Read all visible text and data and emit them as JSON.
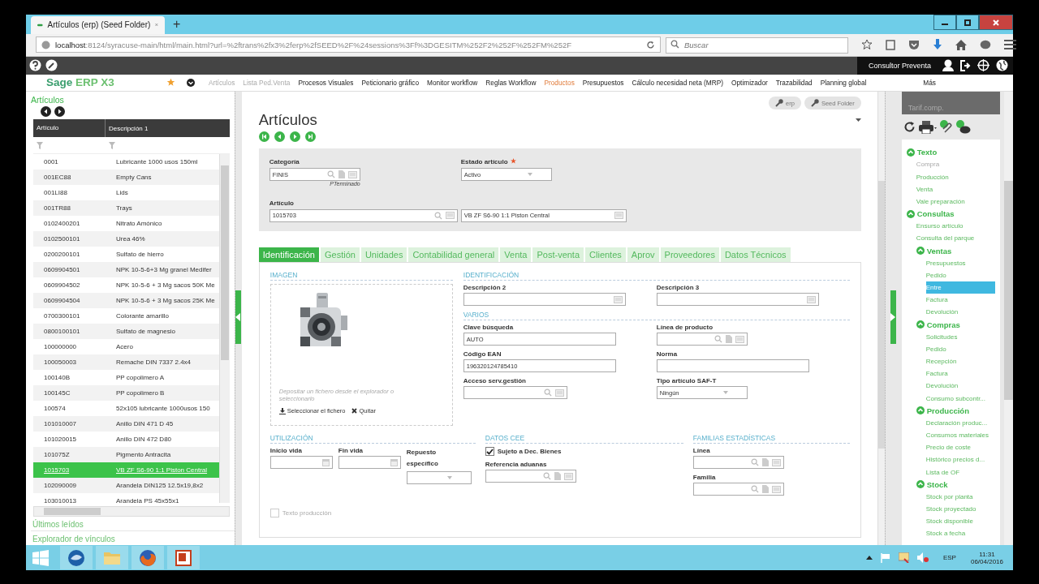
{
  "browser": {
    "tab_title": "Artículos (erp) (Seed Folder)",
    "new_tab": "+",
    "url_host": "localhost",
    "url_rest": ":8124/syracuse-main/html/main.html?url=%2ftrans%2fx3%2ferp%2fSEED%2F%24sessions%3Ff%3DGESITM%252F2%252F%252FM%252F",
    "search_placeholder": "Buscar"
  },
  "user": "Consultor Preventa",
  "app": {
    "logo_main": "Sage",
    "logo_sub": "ERP X3",
    "nav": [
      {
        "label": "Artículos",
        "recent": true,
        "selected": false
      },
      {
        "label": "Lista Ped.Venta",
        "recent": true,
        "selected": false
      },
      {
        "label": "Procesos Visuales",
        "recent": false,
        "selected": false
      },
      {
        "label": "Peticionario gráfico",
        "recent": false,
        "selected": false
      },
      {
        "label": "Monitor workflow",
        "recent": false,
        "selected": false
      },
      {
        "label": "Reglas Workflow",
        "recent": false,
        "selected": false
      },
      {
        "label": "Productos",
        "recent": false,
        "selected": true
      },
      {
        "label": "Presupuestos",
        "recent": false,
        "selected": false
      },
      {
        "label": "Cálculo necesidad neta (MRP)",
        "recent": false,
        "selected": false
      },
      {
        "label": "Optimizador",
        "recent": false,
        "selected": false
      },
      {
        "label": "Trazabilidad",
        "recent": false,
        "selected": false
      },
      {
        "label": "Planning global",
        "recent": false,
        "selected": false
      },
      {
        "label": "Más",
        "recent": false,
        "selected": false
      }
    ]
  },
  "left_panel": {
    "title": "Artículos",
    "columns": [
      "Artículo",
      "Descripción 1"
    ],
    "rows": [
      {
        "code": "0001",
        "desc": "Lubricante 1000 usos 150ml",
        "selected": false
      },
      {
        "code": "001EC88",
        "desc": "Empty Cans",
        "selected": false
      },
      {
        "code": "001LI88",
        "desc": "Lids",
        "selected": false
      },
      {
        "code": "001TR88",
        "desc": "Trays",
        "selected": false
      },
      {
        "code": "0102400201",
        "desc": "Nitrato Amónico",
        "selected": false
      },
      {
        "code": "0102500101",
        "desc": "Urea 46%",
        "selected": false
      },
      {
        "code": "0200200101",
        "desc": "Sulfato de hierro",
        "selected": false
      },
      {
        "code": "0609904501",
        "desc": "NPK 10-5-6+3 Mg granel Medifer",
        "selected": false
      },
      {
        "code": "0609904502",
        "desc": "NPK 10-5-6 + 3 Mg sacos 50K Me",
        "selected": false
      },
      {
        "code": "0609904504",
        "desc": "NPK 10-5-6 + 3 Mg sacos 25K Me",
        "selected": false
      },
      {
        "code": "0700300101",
        "desc": "Colorante amarillo",
        "selected": false
      },
      {
        "code": "0800100101",
        "desc": "Sulfato de magnesio",
        "selected": false
      },
      {
        "code": "100000000",
        "desc": "Acero",
        "selected": false
      },
      {
        "code": "100050003",
        "desc": "Remache DIN 7337 2.4x4",
        "selected": false
      },
      {
        "code": "100140B",
        "desc": "PP copolimero A",
        "selected": false
      },
      {
        "code": "100145C",
        "desc": "PP copolimero B",
        "selected": false
      },
      {
        "code": "100574",
        "desc": "52x105 lubricante 1000usos 150",
        "selected": false
      },
      {
        "code": "101010007",
        "desc": "Anillo DIN 471 D 45",
        "selected": false
      },
      {
        "code": "101020015",
        "desc": "Anillo DIN 472 D80",
        "selected": false
      },
      {
        "code": "101075Z",
        "desc": "Pigmento Antracita",
        "selected": false
      },
      {
        "code": "1015703",
        "desc": "VB ZF S6-90 1:1 Piston Central",
        "selected": true
      },
      {
        "code": "102090009",
        "desc": "Arandela DIN125 12.5x19,8x2",
        "selected": false
      },
      {
        "code": "103010013",
        "desc": "Arandela PS 45x55x1",
        "selected": false
      }
    ],
    "links": [
      "Últimos leídos",
      "Explorador de vínculos"
    ]
  },
  "main": {
    "chips": [
      "erp",
      "Seed Folder"
    ],
    "title": "Artículos",
    "header_fields": [
      {
        "label": "Categoría",
        "kind": "lookup",
        "value": "FINIS",
        "hint": "PTerminado"
      },
      {
        "label": "Estado artículo",
        "kind": "select",
        "value": "Activo",
        "required": true
      },
      {
        "label": "Artículo",
        "kind": "search",
        "value": "1015703"
      },
      {
        "kind": "memo",
        "value": "VB ZF S6-90 1:1 Piston Central"
      }
    ],
    "tabs": [
      {
        "label": "Identificación",
        "selected": true
      },
      {
        "label": "Gestión",
        "selected": false
      },
      {
        "label": "Unidades",
        "selected": false
      },
      {
        "label": "Contabilidad general",
        "selected": false
      },
      {
        "label": "Venta",
        "selected": false
      },
      {
        "label": "Post-venta",
        "selected": false
      },
      {
        "label": "Clientes",
        "selected": false
      },
      {
        "label": "Aprov",
        "selected": false
      },
      {
        "label": "Proveedores",
        "selected": false
      },
      {
        "label": "Datos Técnicos",
        "selected": false
      }
    ],
    "image_section": {
      "title": "IMAGEN",
      "drop_hint": "Depositar un fichero desde el explorador o seleccionarlo",
      "select_action": "Seleccionar el fichero",
      "remove_action": "Quitar"
    },
    "sections": [
      {
        "title": "IDENTIFICACIÓN",
        "rows": [
          [
            {
              "label": "Descripción 2",
              "kind": "memo"
            },
            {
              "label": "Descripción 3",
              "kind": "memo"
            }
          ]
        ]
      },
      {
        "title": "VARIOS",
        "rows": [
          [
            {
              "label": "Clave búsqueda",
              "kind": "text",
              "value": "AUTO"
            },
            {
              "label": "Línea de producto",
              "kind": "lookup"
            }
          ],
          [
            {
              "label": "Código EAN",
              "kind": "text",
              "value": "196320124785410"
            },
            {
              "label": "Norma",
              "kind": "text"
            }
          ],
          [
            {
              "label": "Acceso serv.gestión",
              "kind": "search"
            },
            {
              "label": "Tipo artículo SAF-T",
              "kind": "select",
              "value": "Ningún"
            }
          ]
        ]
      }
    ],
    "bottom_sections": [
      {
        "title": "UTILIZACIÓN",
        "rows": [
          [
            {
              "label": "Inicio vida",
              "kind": "date"
            },
            {
              "label": "Fin vida",
              "kind": "date"
            },
            {
              "label": "Repuesto específico",
              "kind": "select"
            }
          ],
          [
            {
              "label": "Texto producción",
              "kind": "check",
              "checked": false,
              "disabled": true
            }
          ]
        ]
      },
      {
        "title": "DATOS CEE",
        "rows": [
          [
            {
              "label": "Sujeto a Dec. Bienes",
              "kind": "check",
              "checked": true,
              "disabled": false
            }
          ],
          [
            {
              "label": "Referencia aduanas",
              "kind": "lookup"
            }
          ]
        ]
      },
      {
        "title": "FAMILIAS ESTADÍSTICAS",
        "rows": [
          [
            {
              "label": "Línea",
              "kind": "lookup"
            }
          ],
          [
            {
              "label": "Familia",
              "kind": "lookup"
            }
          ]
        ]
      }
    ]
  },
  "right_panel": {
    "caption": "Tarif.comp.",
    "tree": [
      {
        "label": "Texto",
        "expanded": true,
        "children": [
          {
            "label": "Compra",
            "selected": false,
            "disabled": true
          },
          {
            "label": "Producción",
            "selected": false,
            "disabled": false
          },
          {
            "label": "Venta",
            "selected": false,
            "disabled": false
          },
          {
            "label": "Vale preparación",
            "selected": false,
            "disabled": false
          }
        ]
      },
      {
        "label": "Consultas",
        "expanded": true,
        "children": [
          {
            "label": "Ensurso artículo",
            "selected": false,
            "disabled": false
          },
          {
            "label": "Consulta del parque",
            "selected": false,
            "disabled": false
          },
          {
            "label": "Ventas",
            "expanded": true,
            "children": [
              {
                "label": "Presupuestos",
                "selected": false,
                "disabled": false
              },
              {
                "label": "Pedido",
                "selected": false,
                "disabled": false
              },
              {
                "label": "Entre",
                "selected": true,
                "disabled": false
              },
              {
                "label": "Factura",
                "selected": false,
                "disabled": false
              },
              {
                "label": "Devolución",
                "selected": false,
                "disabled": false
              }
            ]
          },
          {
            "label": "Compras",
            "expanded": true,
            "children": [
              {
                "label": "Solicitudes",
                "selected": false,
                "disabled": false
              },
              {
                "label": "Pedido",
                "selected": false,
                "disabled": false
              },
              {
                "label": "Recepción",
                "selected": false,
                "disabled": false
              },
              {
                "label": "Factura",
                "selected": false,
                "disabled": false
              },
              {
                "label": "Devolución",
                "selected": false,
                "disabled": false
              },
              {
                "label": "Consumo subcontr...",
                "selected": false,
                "disabled": false
              }
            ]
          },
          {
            "label": "Producción",
            "expanded": true,
            "children": [
              {
                "label": "Declaración produc...",
                "selected": false,
                "disabled": false
              },
              {
                "label": "Consumos materiales",
                "selected": false,
                "disabled": false
              },
              {
                "label": "Precio de coste",
                "selected": false,
                "disabled": false
              },
              {
                "label": "Histórico precios d...",
                "selected": false,
                "disabled": false
              },
              {
                "label": "Lista de OF",
                "selected": false,
                "disabled": false
              }
            ]
          },
          {
            "label": "Stock",
            "expanded": true,
            "children": [
              {
                "label": "Stock por planta",
                "selected": false,
                "disabled": false
              },
              {
                "label": "Stock proyectado",
                "selected": false,
                "disabled": false
              },
              {
                "label": "Stock disponible",
                "selected": false,
                "disabled": false
              },
              {
                "label": "Stock a fecha",
                "selected": false,
                "disabled": false
              }
            ]
          }
        ]
      }
    ]
  },
  "taskbar": {
    "language": "ESP",
    "time": "11:31",
    "date": "06/04/2016"
  }
}
